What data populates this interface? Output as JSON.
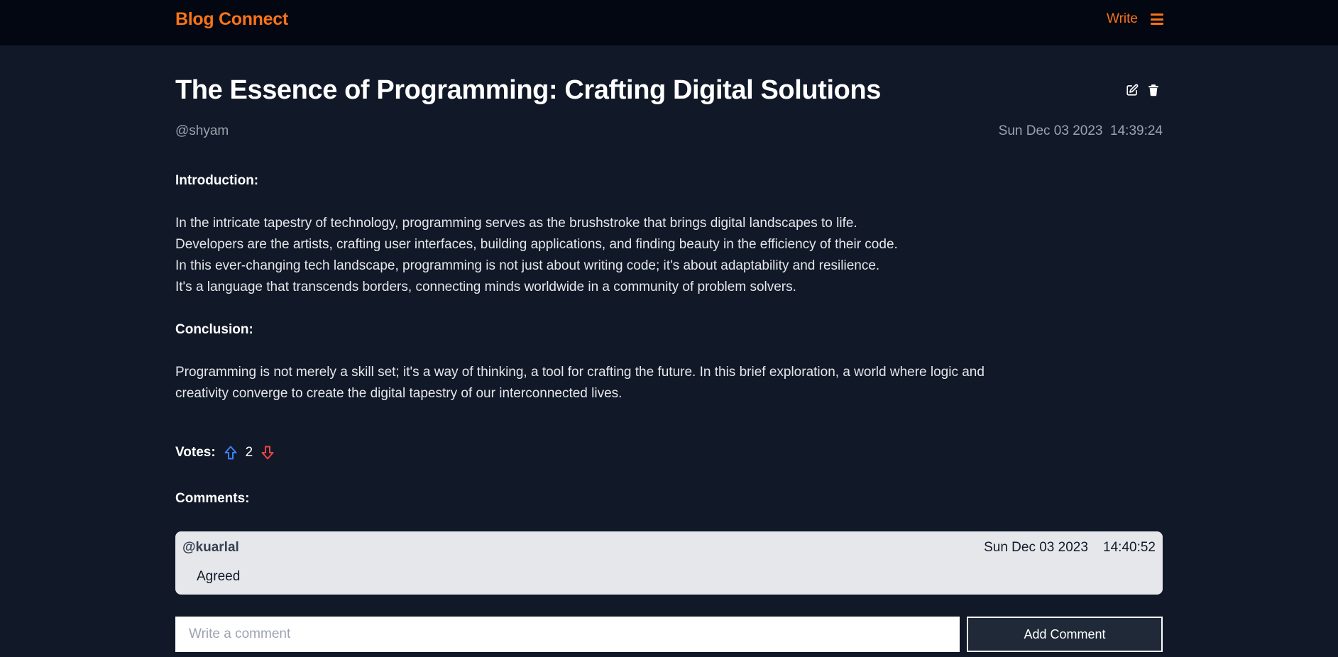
{
  "app": {
    "brand": "Blog Connect",
    "write_label": "Write",
    "menu_icon": "hamburger-menu-icon",
    "accent_color": "#f97316"
  },
  "post": {
    "title": "The Essence of Programming: Crafting Digital Solutions",
    "author": "@shyam",
    "date": "Sun Dec 03 2023  14:39:24",
    "edit_icon": "edit-icon",
    "delete_icon": "trash-icon",
    "intro_heading": "Introduction:",
    "intro_lines": [
      "In the intricate tapestry of technology, programming serves as the brushstroke that brings digital landscapes to life.",
      "Developers are the artists, crafting user interfaces, building applications, and finding beauty in the efficiency of their code.",
      "In this ever-changing tech landscape, programming is not just about writing code; it's about adaptability and resilience.",
      "It's a language that transcends borders, connecting minds worldwide in a community of problem solvers."
    ],
    "conclusion_heading": "Conclusion:",
    "conclusion_text": "Programming is not merely a skill set; it's a way of thinking, a tool for crafting the future. In this brief exploration, a world where logic and creativity converge to create the digital tapestry of our interconnected lives."
  },
  "votes": {
    "label": "Votes:",
    "count": "2",
    "upvote_color": "#3b82f6",
    "downvote_color": "#ef4444"
  },
  "comments": {
    "label": "Comments:",
    "items": [
      {
        "author": "@kuarlal",
        "date": "Sun Dec 03 2023    14:40:52",
        "text": "Agreed"
      }
    ],
    "input_placeholder": "Write a comment",
    "add_label": "Add Comment"
  }
}
